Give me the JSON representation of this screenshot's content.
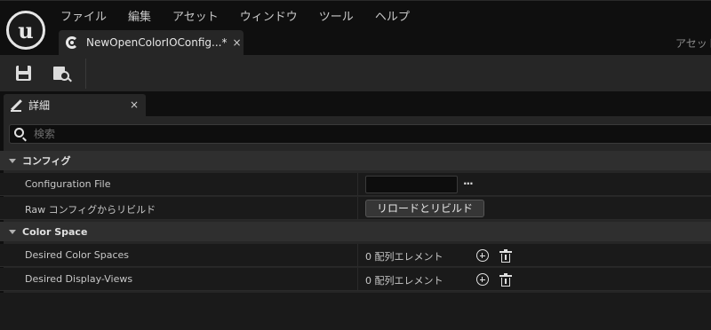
{
  "menu": {
    "items": [
      "ファイル",
      "編集",
      "アセット",
      "ウィンドウ",
      "ツール",
      "ヘルプ"
    ]
  },
  "document_tab": {
    "title": "NewOpenColorIOConfig...*",
    "close_glyph": "×",
    "icon": "opencolorio-icon"
  },
  "header_right": {
    "asset_label": "アセット"
  },
  "toolbar": {
    "save_icon": "save-icon",
    "browse_icon": "browse-to-asset-icon"
  },
  "details_tab": {
    "title": "詳細",
    "close_glyph": "×",
    "icon": "pencil-icon"
  },
  "search": {
    "placeholder": "検索",
    "value": ""
  },
  "categories": [
    {
      "label": "コンフィグ",
      "properties": [
        {
          "name": "Configuration File",
          "value": "",
          "extra": "..."
        },
        {
          "name": "Raw コンフィグからリビルド",
          "button": "リロードとリビルド"
        }
      ]
    },
    {
      "label": "Color Space",
      "properties": [
        {
          "name": "Desired Color Spaces",
          "value": "0 配列エレメント"
        },
        {
          "name": "Desired Display-Views",
          "value": "0 配列エレメント"
        }
      ]
    }
  ],
  "colors": {
    "panel_bg": "#262626",
    "row_bg": "#1a1a1a",
    "header_bg": "#0f0f0f",
    "category_bg": "#2f2f2f"
  }
}
